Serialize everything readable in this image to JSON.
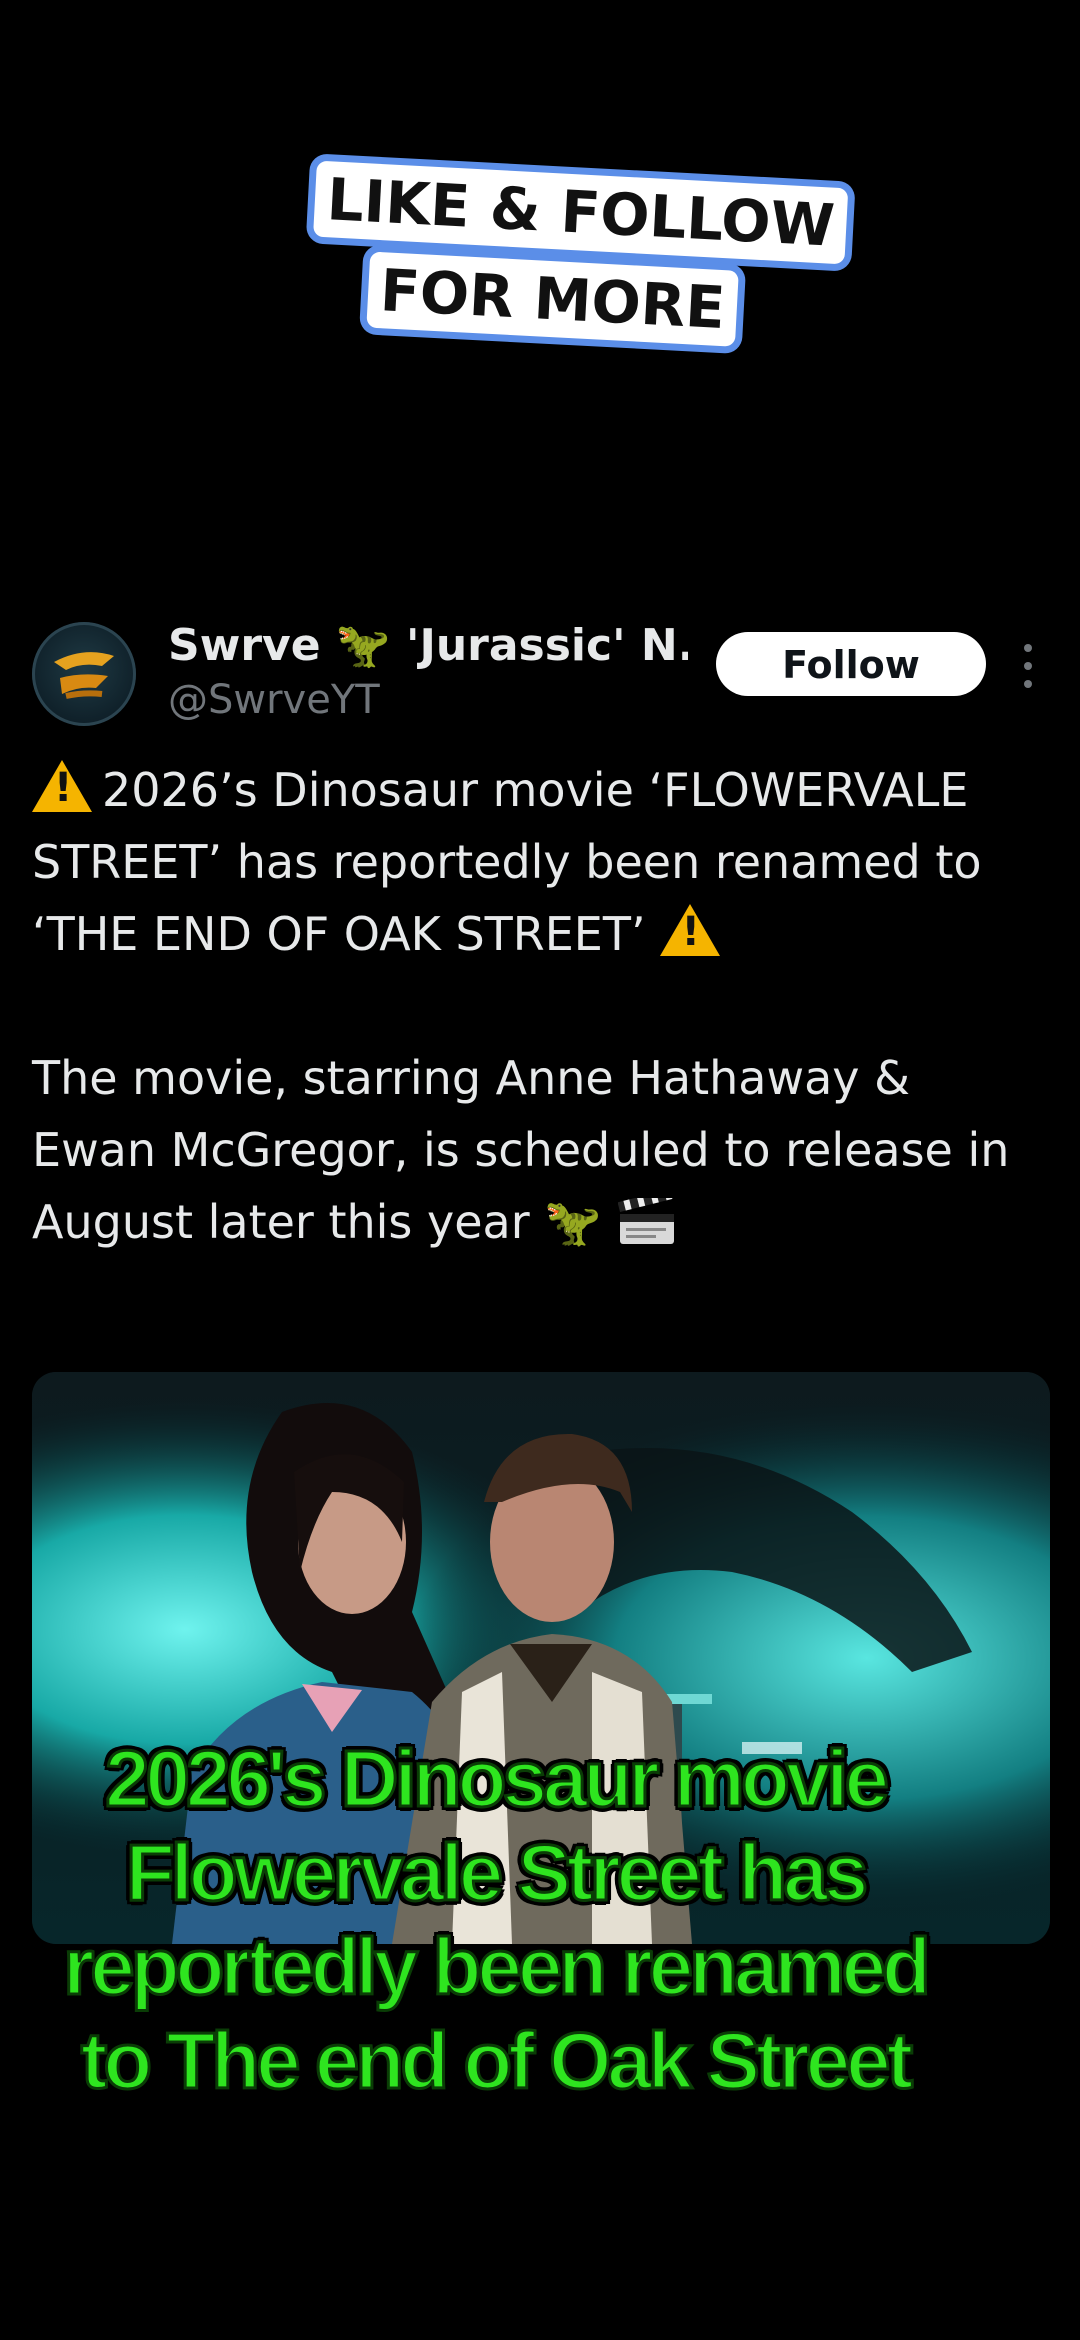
{
  "sticker": {
    "line1": "LIKE & FOLLOW",
    "line2": "FOR MORE"
  },
  "tweet": {
    "display_name": "Swrve 🦖 'Jurassic' N...",
    "handle": "@SwrveYT",
    "follow_label": "Follow",
    "paragraph1": "2026’s Dinosaur movie ‘FLOWERVALE STREET’ has reportedly been renamed to ‘THE END OF OAK STREET’",
    "paragraph2": "The movie, starring Anne Hathaway & Ewan McGregor, is scheduled to release in August later this year",
    "dino_emoji": "🦖"
  },
  "caption": {
    "line1": "2026's Dinosaur movie",
    "line2": "Flowervale Street has",
    "line3": "reportedly been renamed",
    "line4": "to The end of Oak Street"
  },
  "colors": {
    "background": "#000000",
    "caption_green": "#2ee51f",
    "sticker_border": "#5b8ee8",
    "follow_bg": "#ffffff",
    "handle_gray": "#71767b",
    "warning_yellow": "#f5b400"
  },
  "icons": {
    "avatar": "swrve-logo-avatar",
    "more": "vertical-dots-icon",
    "warning": "warning-icon",
    "clapper": "clapper-board-icon"
  }
}
